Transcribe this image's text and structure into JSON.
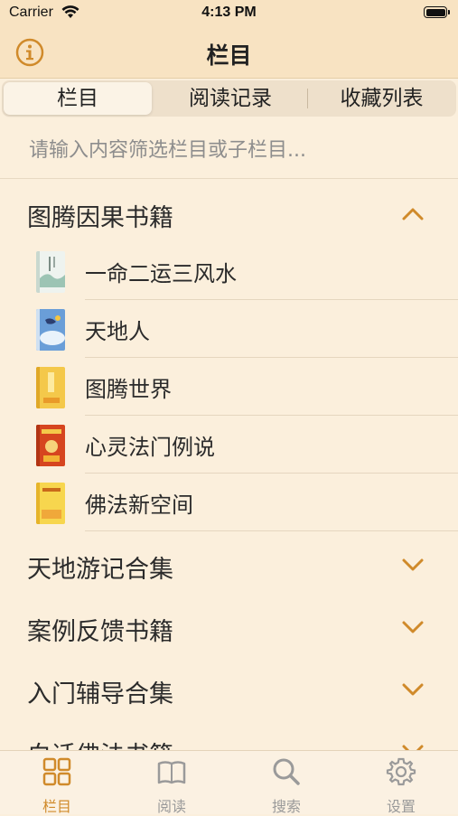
{
  "status_bar": {
    "carrier": "Carrier",
    "time": "4:13 PM"
  },
  "nav": {
    "title": "栏目"
  },
  "segments": [
    {
      "label": "栏目",
      "active": true
    },
    {
      "label": "阅读记录",
      "active": false
    },
    {
      "label": "收藏列表",
      "active": false
    }
  ],
  "search": {
    "placeholder": "请输入内容筛选栏目或子栏目...",
    "value": ""
  },
  "sections": [
    {
      "label": "图腾因果书籍",
      "expanded": true,
      "items": [
        {
          "label": "一命二运三风水",
          "cover": "cover-white-landscape"
        },
        {
          "label": "天地人",
          "cover": "cover-blue-sky"
        },
        {
          "label": "图腾世界",
          "cover": "cover-yellow"
        },
        {
          "label": "心灵法门例说",
          "cover": "cover-red-orange"
        },
        {
          "label": "佛法新空间",
          "cover": "cover-yellow-orange"
        }
      ]
    },
    {
      "label": "天地游记合集",
      "expanded": false
    },
    {
      "label": "案例反馈书籍",
      "expanded": false
    },
    {
      "label": "入门辅导合集",
      "expanded": false
    },
    {
      "label": "白话佛法书籍",
      "expanded": false
    }
  ],
  "tabs": [
    {
      "label": "栏目",
      "icon": "grid-icon",
      "active": true
    },
    {
      "label": "阅读",
      "icon": "book-icon",
      "active": false
    },
    {
      "label": "搜索",
      "icon": "search-icon",
      "active": false
    },
    {
      "label": "设置",
      "icon": "gear-icon",
      "active": false
    }
  ],
  "colors": {
    "accent": "#d08a2a",
    "header_bg": "#f8e3c2",
    "page_bg": "#fbefdc",
    "inactive_tab": "#9a9a9a"
  }
}
